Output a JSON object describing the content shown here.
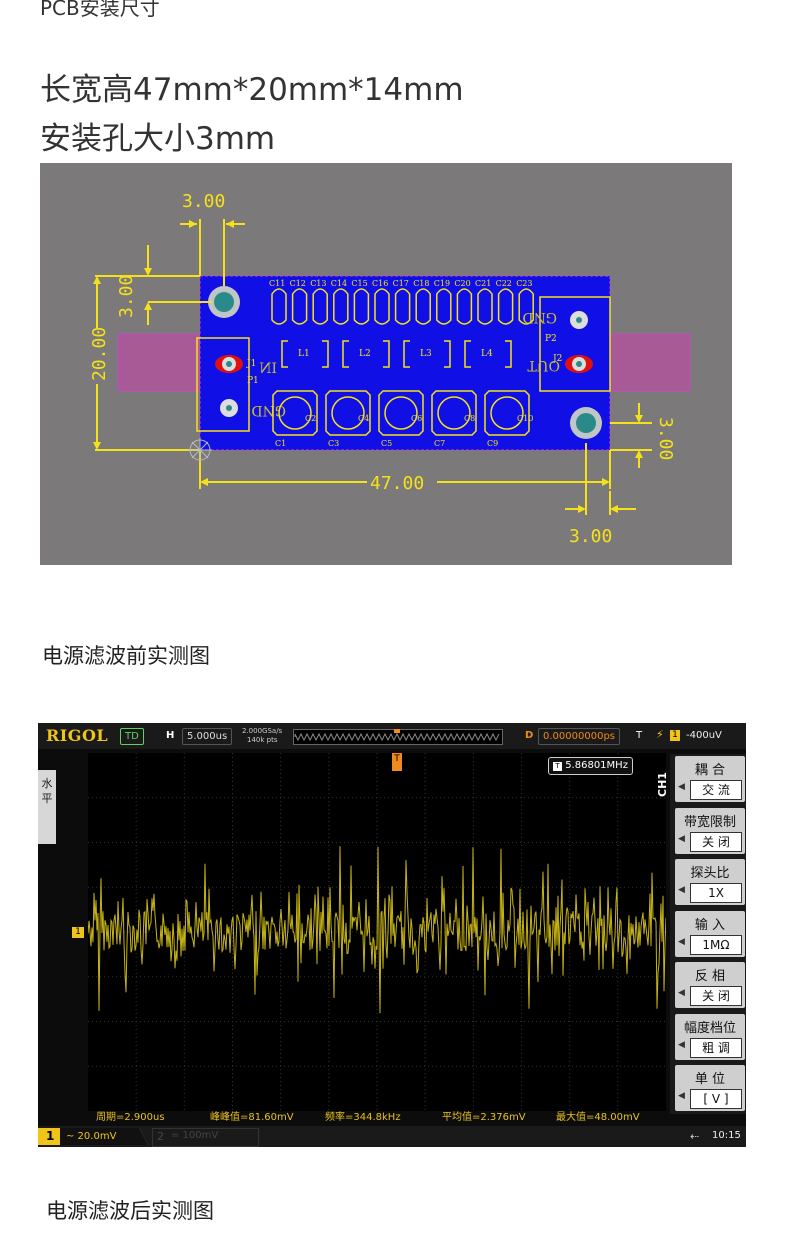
{
  "text": {
    "section_heading": "PCB安装尺寸",
    "spec_line_1": "长宽高47mm*20mm*14mm",
    "spec_line_2": "安装孔大小3mm",
    "caption_before": "电源滤波前实测图",
    "caption_after": "电源滤波后实测图"
  },
  "pcb": {
    "dims": {
      "top_offset": "3.00",
      "left_offset": "3.00",
      "height": "20.00",
      "width": "47.00",
      "right_offset": "3.00",
      "bottom_offset": "3.00"
    },
    "caps_top": [
      "C11",
      "C12",
      "C13",
      "C14",
      "C15",
      "C16",
      "C17",
      "C18",
      "C19",
      "C20",
      "C21",
      "C22",
      "C23"
    ],
    "inductors": [
      "L1",
      "L2",
      "L3",
      "L4"
    ],
    "caps_bottom_a": [
      "C1",
      "C3",
      "C5",
      "C7",
      "C9"
    ],
    "caps_bottom_b": [
      "C2",
      "C4",
      "C6",
      "C8",
      "C10"
    ],
    "labels": {
      "j1": "J1",
      "p1": "P1",
      "in": "IN",
      "gnd_left": "GND",
      "p2": "P2",
      "j2": "J2",
      "out": "OUT",
      "gnd_right": "GND"
    },
    "colors": {
      "board": "#1010e6",
      "dimension": "#f5e11a",
      "background": "#7b7979",
      "silkscreen": "#f5e11a"
    }
  },
  "scope": {
    "brand": "RIGOL",
    "mode": "TD",
    "h_label": "H",
    "timebase": "5.000us",
    "sample_rate": "2.000GSa/s",
    "points": "140k pts",
    "delay_label": "D",
    "delay": "0.00000000ps",
    "trigger_label": "T",
    "trigger_level": "-400uV",
    "side_label": "水平",
    "channel_tag": "CH1",
    "freq_counter": "5.86801MHz",
    "trigger_marker": "T",
    "ch_marker": "1",
    "menu": [
      {
        "title": "耦 合",
        "value": "交 流"
      },
      {
        "title": "带宽限制",
        "value": "关 闭"
      },
      {
        "title": "探头比",
        "value": "1X"
      },
      {
        "title": "输 入",
        "value": "1MΩ"
      },
      {
        "title": "反 相",
        "value": "关 闭"
      },
      {
        "title": "幅度档位",
        "value": "粗 调"
      },
      {
        "title": "单 位",
        "value": "[ V ]"
      }
    ],
    "measurements": [
      "周期=2.900us",
      "峰峰值=81.60mV",
      "频率=344.8kHz",
      "平均值=2.376mV",
      "最大值=48.00mV"
    ],
    "ch1_num": "1",
    "ch1_scale": "~ 20.0mV",
    "ch2_num": "2",
    "ch2_scale": "= 100mV",
    "time": "10:15",
    "colors": {
      "trace": "#e8d21a",
      "accent": "#f0c419",
      "grid": "#3a3a3a"
    }
  }
}
